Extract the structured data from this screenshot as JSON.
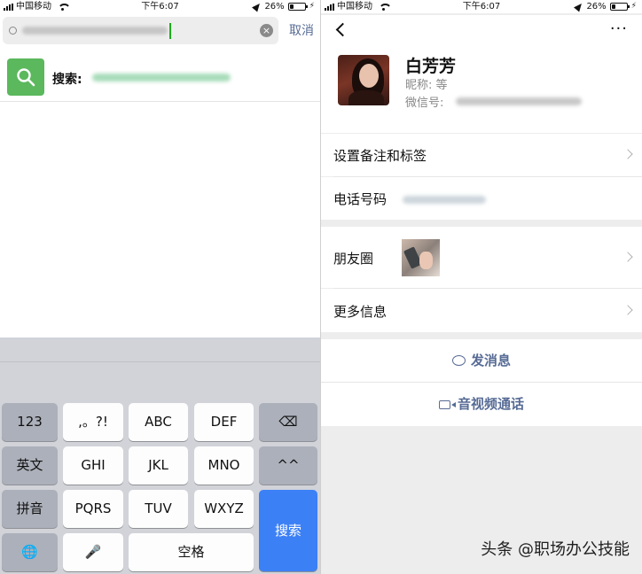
{
  "left": {
    "status": {
      "carrier": "中国移动",
      "time": "下午6:07",
      "battery": "26%",
      "battery_level": 0.26
    },
    "search": {
      "cancel_label": "取消",
      "clear_glyph": "×"
    },
    "result": {
      "label": "搜索:"
    },
    "keyboard": {
      "rows": [
        [
          {
            "key": "123",
            "style": "dark"
          },
          {
            "key": ",。?!",
            "style": "light"
          },
          {
            "key": "ABC",
            "style": "light"
          },
          {
            "key": "DEF",
            "style": "light"
          },
          {
            "key": "⌫",
            "style": "dark",
            "icon": "backspace-icon"
          }
        ],
        [
          {
            "key": "英文",
            "style": "dark"
          },
          {
            "key": "GHI",
            "style": "light"
          },
          {
            "key": "JKL",
            "style": "light"
          },
          {
            "key": "MNO",
            "style": "light"
          },
          {
            "key": "^^",
            "style": "dark"
          }
        ],
        [
          {
            "key": "拼音",
            "style": "dark"
          },
          {
            "key": "PQRS",
            "style": "light"
          },
          {
            "key": "TUV",
            "style": "light"
          },
          {
            "key": "WXYZ",
            "style": "light"
          }
        ],
        [
          {
            "key": "🌐",
            "style": "dark",
            "icon": "globe-icon"
          },
          {
            "key": "🎤",
            "style": "light",
            "icon": "microphone-icon"
          },
          {
            "key": "空格",
            "style": "light"
          }
        ]
      ],
      "search_key": "搜索",
      "search_key_color": "#3c80f6"
    }
  },
  "right": {
    "status": {
      "carrier": "中国移动",
      "time": "下午6:07",
      "battery": "26%",
      "battery_level": 0.26
    },
    "nav": {
      "more": "···"
    },
    "profile": {
      "name": "白芳芳",
      "nickname": "昵称: 等",
      "wechat_id_label": "微信号:"
    },
    "cells": {
      "remark": "设置备注和标签",
      "phone": "电话号码",
      "moments": "朋友圈",
      "more_info": "更多信息"
    },
    "actions": {
      "message": "发消息",
      "call": "音视频通话"
    },
    "link_color": "#576b95"
  },
  "watermark": "头条 @职场办公技能"
}
